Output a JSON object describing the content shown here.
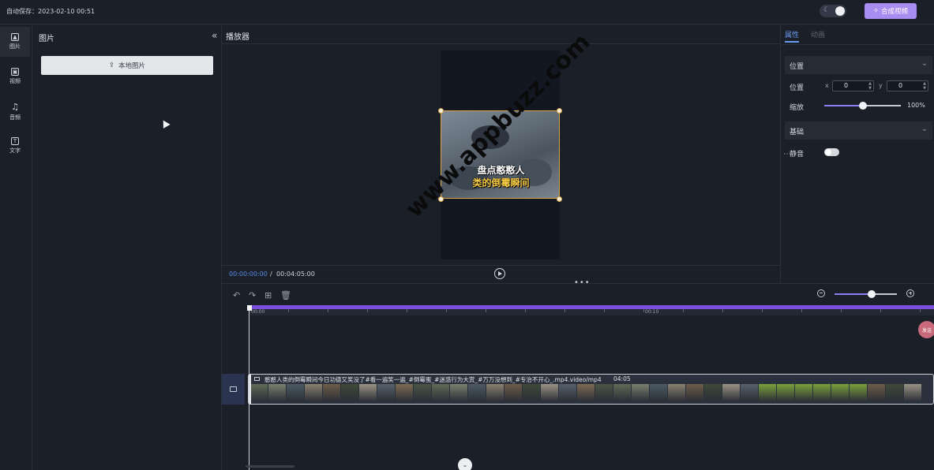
{
  "topbar": {
    "autosave": "自动保存：2023-02-10 00:51",
    "theme_icon": "moon-icon",
    "export_label": "合成视频",
    "export_icon": "sparkle-icon",
    "accent_color": "#a98cf0"
  },
  "nav": {
    "items": [
      {
        "label": "图片",
        "icon": "image-icon"
      },
      {
        "label": "视频",
        "icon": "video-icon"
      },
      {
        "label": "音频",
        "icon": "music-icon"
      },
      {
        "label": "文字",
        "icon": "text-icon"
      }
    ]
  },
  "image_panel": {
    "title": "图片",
    "collapse_icon": "double-chevron-left-icon",
    "local_button": "本地图片",
    "upload_icon": "upload-icon"
  },
  "player": {
    "title": "播放器",
    "caption_line1": "盘点憨憨人",
    "caption_line2": "类的倒霉瞬间",
    "watermark": "www.appbuzz.com",
    "time_current": "00:00:00:00",
    "time_separator": "/",
    "time_total": "00:04:05:00",
    "play_icon": "play-circle-icon"
  },
  "properties": {
    "tabs": [
      "属性",
      "动画"
    ],
    "active_tab": "属性",
    "position_section": "位置",
    "position_label": "位置",
    "x_label": "x",
    "x_value": "0",
    "y_label": "y",
    "y_value": "0",
    "scale_label": "缩放",
    "scale_value": "100%",
    "scale_slider_fraction": 0.5,
    "basic_section": "基础",
    "mute_label": "静音",
    "mute_on": false
  },
  "timeline": {
    "ruler_labels": [
      "00:00",
      "00:10"
    ],
    "zoom_slider_fraction": 0.6,
    "track_title": "憨憨人类的倒霉瞬间今日功德又笑没了#看一遍笑一遍_#倒霉蛋_#迷惑行为大赏_#万万没想到_#专治不开心_.mp4.video/mp4",
    "track_duration": "04:05",
    "tool_icons": [
      "undo-icon",
      "redo-icon",
      "grid-icon",
      "trash-icon"
    ],
    "bubble_text": "发送"
  }
}
